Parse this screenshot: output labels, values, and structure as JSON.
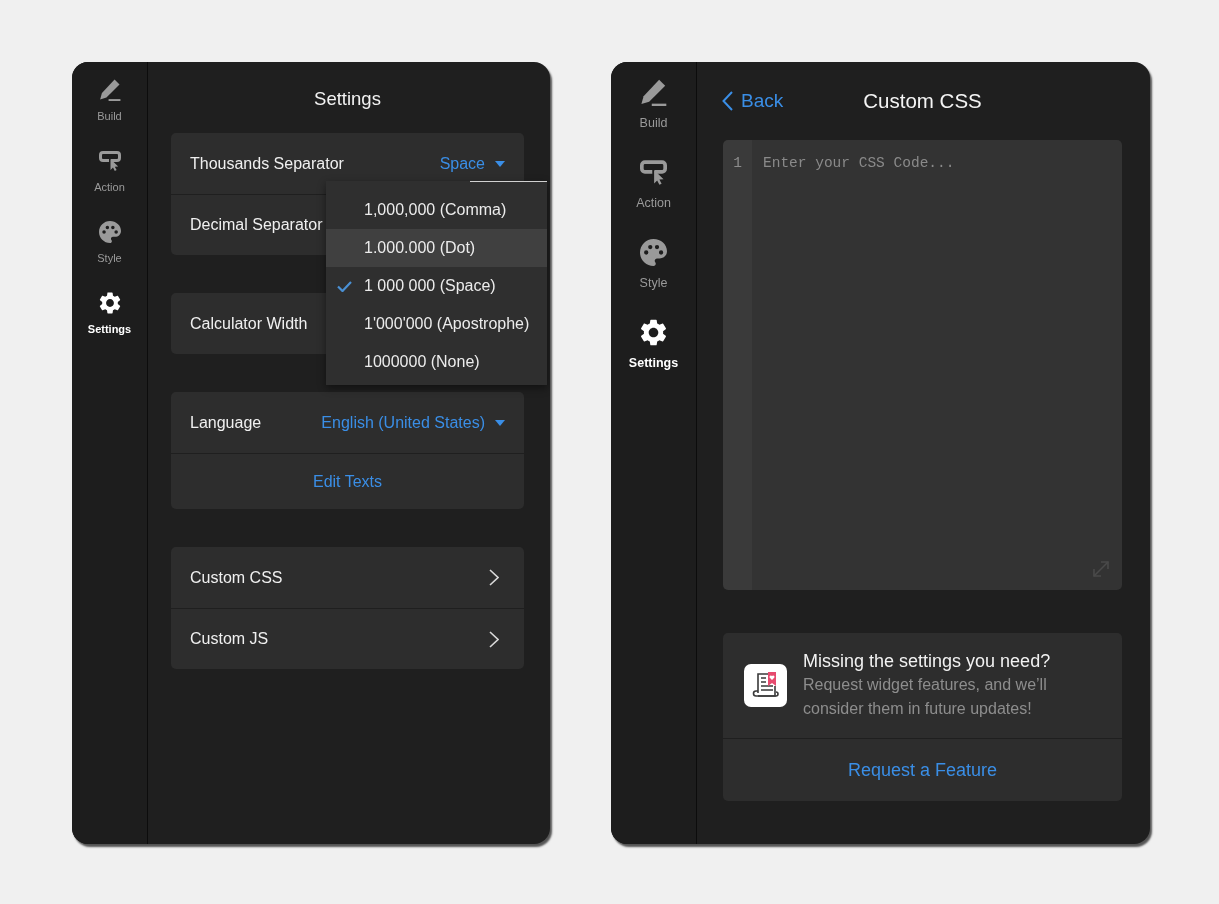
{
  "settings_panel": {
    "sidebar": {
      "items": [
        {
          "label": "Build",
          "selected": false
        },
        {
          "label": "Action",
          "selected": false
        },
        {
          "label": "Style",
          "selected": false
        },
        {
          "label": "Settings",
          "selected": true
        }
      ]
    },
    "title": "Settings",
    "groups": [
      {
        "rows": [
          {
            "kind": "select",
            "label": "Thousands Separator",
            "value": "Space"
          },
          {
            "kind": "label",
            "label": "Decimal Separator"
          }
        ]
      },
      {
        "rows": [
          {
            "kind": "label",
            "label": "Calculator Width"
          }
        ]
      },
      {
        "rows": [
          {
            "kind": "select",
            "label": "Language",
            "value": "English (United States)"
          },
          {
            "kind": "link",
            "label": "Edit Texts"
          }
        ]
      },
      {
        "rows": [
          {
            "kind": "nav",
            "label": "Custom CSS"
          },
          {
            "kind": "nav",
            "label": "Custom JS"
          }
        ]
      }
    ],
    "dropdown_menu": {
      "options": [
        {
          "label": "1,000,000 (Comma)",
          "selected": false,
          "highlighted": false
        },
        {
          "label": "1.000.000 (Dot)",
          "selected": false,
          "highlighted": true
        },
        {
          "label": "1 000 000 (Space)",
          "selected": true,
          "highlighted": false
        },
        {
          "label": "1'000'000 (Apostrophe)",
          "selected": false,
          "highlighted": false
        },
        {
          "label": "1000000 (None)",
          "selected": false,
          "highlighted": false
        }
      ]
    }
  },
  "custom_css_panel": {
    "sidebar": {
      "items": [
        {
          "label": "Build",
          "selected": false
        },
        {
          "label": "Action",
          "selected": false
        },
        {
          "label": "Style",
          "selected": false
        },
        {
          "label": "Settings",
          "selected": true
        }
      ]
    },
    "back_link": "Back",
    "title": "Custom CSS",
    "editor": {
      "line_numbers": [
        "1"
      ],
      "placeholder": "Enter your CSS Code..."
    },
    "feature_card": {
      "title": "Missing the settings you need?",
      "description": "Request widget features, and we’ll consider them in future updates!",
      "link": "Request a Feature"
    }
  }
}
